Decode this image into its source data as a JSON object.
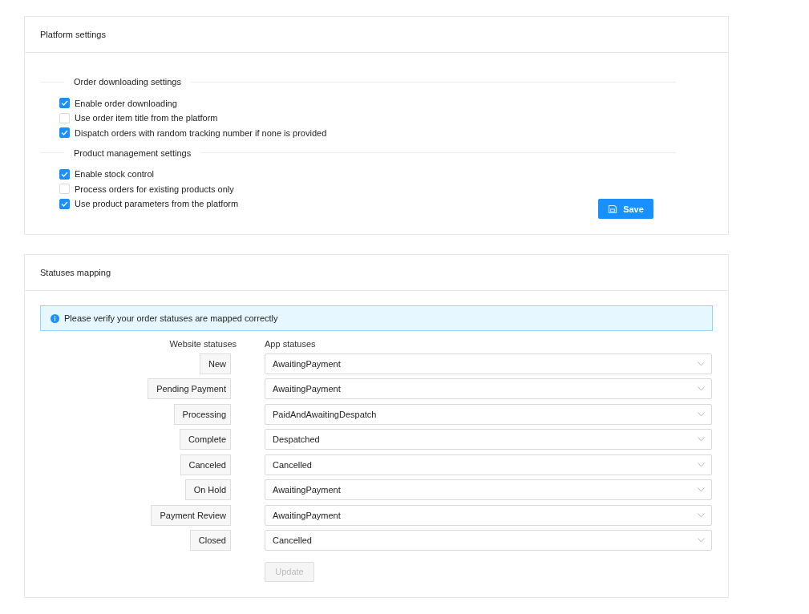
{
  "platform_settings": {
    "title": "Platform settings",
    "sections": [
      {
        "heading": "Order downloading settings",
        "options": [
          {
            "label": "Enable order downloading",
            "checked": true
          },
          {
            "label": "Use order item title from the platform",
            "checked": false
          },
          {
            "label": "Dispatch orders with random tracking number if none is provided",
            "checked": true
          }
        ]
      },
      {
        "heading": "Product management settings",
        "options": [
          {
            "label": "Enable stock control",
            "checked": true
          },
          {
            "label": "Process orders for existing products only",
            "checked": false
          },
          {
            "label": "Use product parameters from the platform",
            "checked": true
          }
        ]
      }
    ],
    "save_button": "Save"
  },
  "statuses_mapping": {
    "title": "Statuses mapping",
    "alert": "Please verify your order statuses are mapped correctly",
    "columns": [
      "Website statuses",
      "App statuses"
    ],
    "rows": [
      {
        "website": "New",
        "app": "AwaitingPayment"
      },
      {
        "website": "Pending Payment",
        "app": "AwaitingPayment"
      },
      {
        "website": "Processing",
        "app": "PaidAndAwaitingDespatch"
      },
      {
        "website": "Complete",
        "app": "Despatched"
      },
      {
        "website": "Canceled",
        "app": "Cancelled"
      },
      {
        "website": "On Hold",
        "app": "AwaitingPayment"
      },
      {
        "website": "Payment Review",
        "app": "AwaitingPayment"
      },
      {
        "website": "Closed",
        "app": "Cancelled"
      }
    ],
    "update_button": {
      "label": "Update",
      "disabled": true
    }
  }
}
